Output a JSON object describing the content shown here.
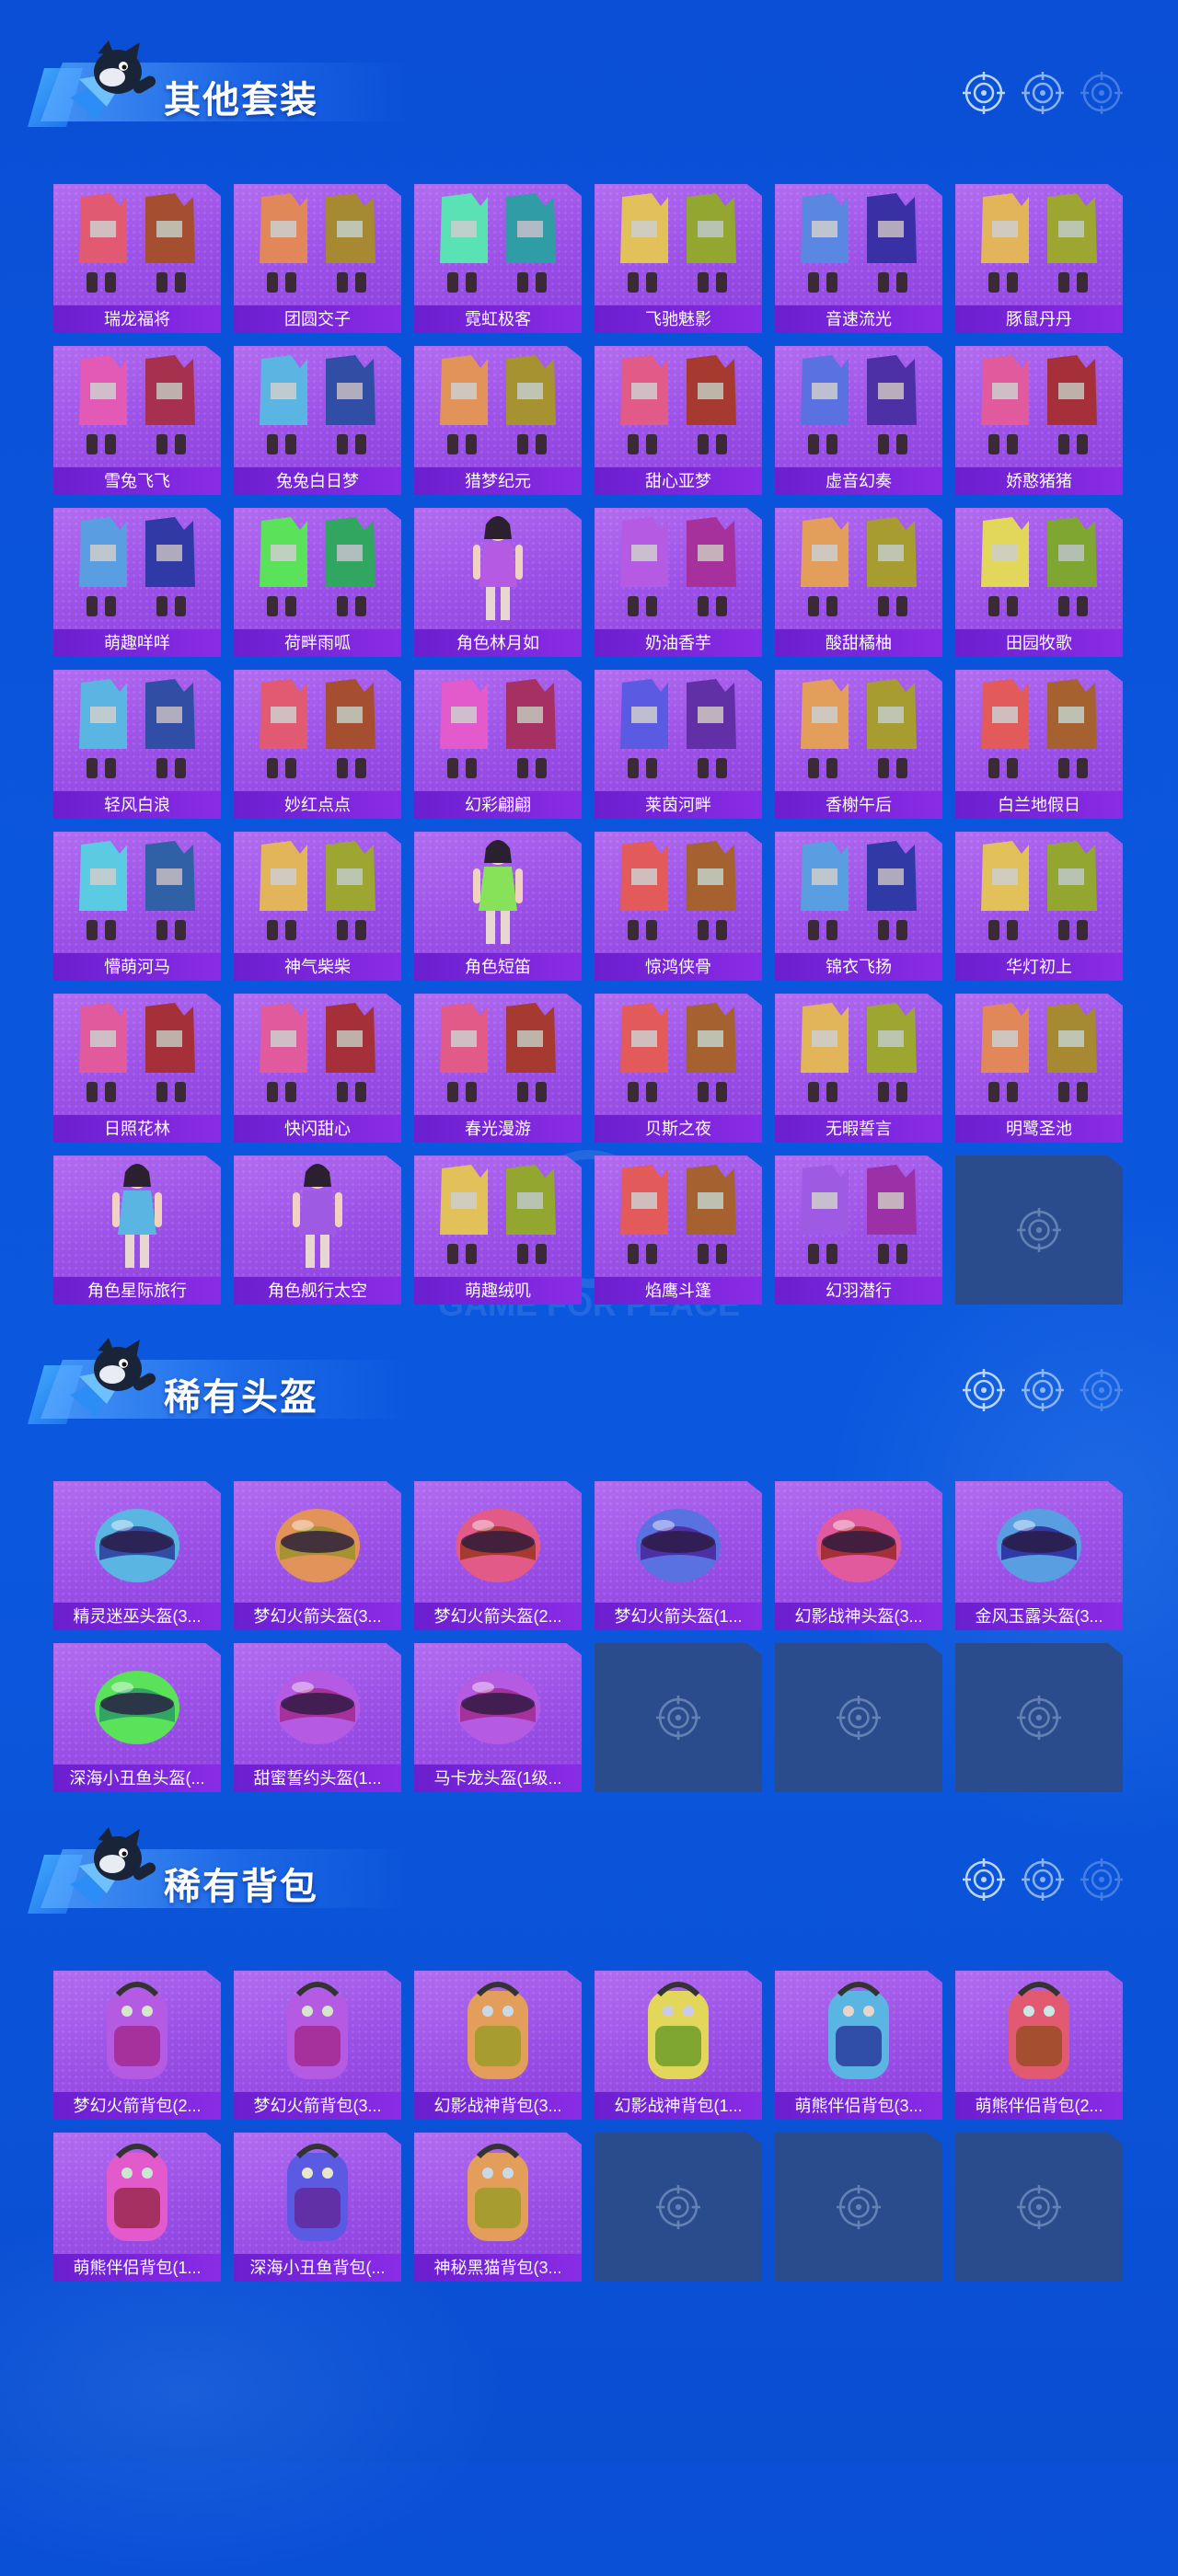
{
  "colors": {
    "background": "#0a55dc",
    "card": "#a25ae8",
    "card_label": "#7a26dc",
    "empty_slot": "#2a4c8c"
  },
  "watermark": "GAME FOR PEACE",
  "sections": [
    {
      "title": "其他套装",
      "icon": "outfit-icon",
      "items": [
        "瑞龙福将",
        "团圆交子",
        "霓虹极客",
        "飞驰魅影",
        "音速流光",
        "豚鼠丹丹",
        "雪兔飞飞",
        "兔兔白日梦",
        "猎梦纪元",
        "甜心亚梦",
        "虚音幻奏",
        "娇憨猪猪",
        "萌趣咩咩",
        "荷畔雨呱",
        "角色林月如",
        "奶油香芋",
        "酸甜橘柚",
        "田园牧歌",
        "轻风白浪",
        "妙红点点",
        "幻彩翩翩",
        "莱茵河畔",
        "香榭午后",
        "白兰地假日",
        "懵萌河马",
        "神气柴柴",
        "角色短笛",
        "惊鸿侠骨",
        "锦衣飞扬",
        "华灯初上",
        "日照花林",
        "快闪甜心",
        "春光漫游",
        "贝斯之夜",
        "无暇誓言",
        "明鹭圣池",
        "角色星际旅行",
        "角色舰行太空",
        "萌趣绒叽",
        "焰鹰斗篷",
        "幻羽潜行"
      ],
      "empty_slots": 1
    },
    {
      "title": "稀有头盔",
      "icon": "helmet-icon",
      "items": [
        "精灵迷巫头盔(3...",
        "梦幻火箭头盔(3...",
        "梦幻火箭头盔(2...",
        "梦幻火箭头盔(1...",
        "幻影战神头盔(3...",
        "金风玉露头盔(3...",
        "深海小丑鱼头盔(...",
        "甜蜜誓约头盔(1...",
        "马卡龙头盔(1级..."
      ],
      "empty_slots": 3
    },
    {
      "title": "稀有背包",
      "icon": "backpack-icon",
      "items": [
        "梦幻火箭背包(2...",
        "梦幻火箭背包(3...",
        "幻影战神背包(3...",
        "幻影战神背包(1...",
        "萌熊伴侣背包(3...",
        "萌熊伴侣背包(2...",
        "萌熊伴侣背包(1...",
        "深海小丑鱼背包(...",
        "神秘黑猫背包(3..."
      ],
      "empty_slots": 3
    }
  ]
}
